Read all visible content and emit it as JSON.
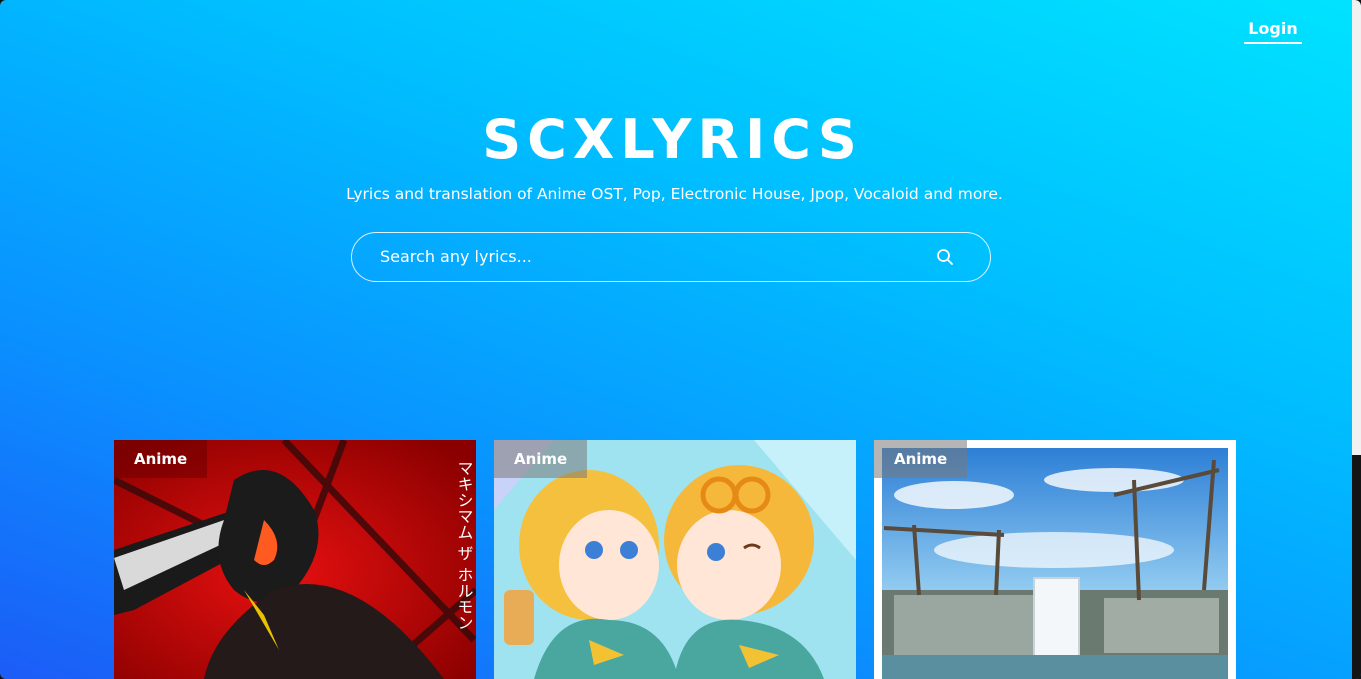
{
  "header": {
    "login_label": "Login"
  },
  "hero": {
    "title": "SCXLYRICS",
    "subtitle": "Lyrics and translation of Anime OST, Pop, Electronic House, Jpop, Vocaloid and more."
  },
  "search": {
    "placeholder": "Search any lyrics...",
    "value": "",
    "icon": "search-icon"
  },
  "cards": [
    {
      "category": "Anime",
      "art_text": "マキシマム ザ ホルモン"
    },
    {
      "category": "Anime"
    },
    {
      "category": "Anime"
    }
  ],
  "colors": {
    "gradient_top": "#00e3ff",
    "gradient_bottom": "#1c5cf7",
    "text": "#ffffff"
  }
}
